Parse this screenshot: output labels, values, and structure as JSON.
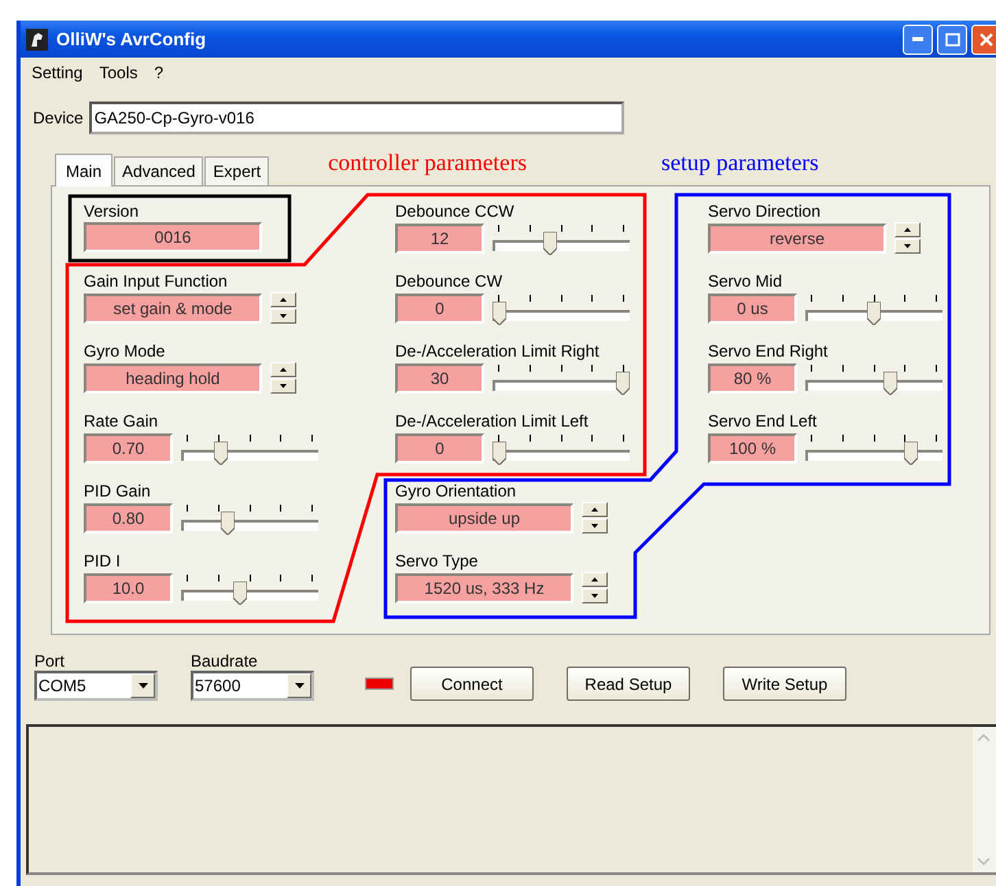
{
  "window": {
    "title": "OlliW's AvrConfig"
  },
  "menu": [
    "Setting",
    "Tools",
    "?"
  ],
  "device": {
    "label": "Device",
    "value": "GA250-Cp-Gyro-v016"
  },
  "tabs": [
    {
      "label": "Main",
      "selected": true
    },
    {
      "label": "Advanced",
      "selected": false
    },
    {
      "label": "Expert",
      "selected": false
    }
  ],
  "annotations": [
    {
      "label": "controller parameters",
      "color": "#ff0000"
    },
    {
      "label": "setup parameters",
      "color": "#0000ff"
    },
    {
      "color": "#000000"
    }
  ],
  "version": {
    "label": "Version",
    "value": "0016"
  },
  "columns": [
    [
      {
        "kind": "spinner",
        "label": "Gain Input Function",
        "value": "set gain & mode"
      },
      {
        "kind": "spinner",
        "label": "Gyro Mode",
        "value": "heading hold"
      },
      {
        "kind": "slider",
        "label": "Rate Gain",
        "value": "0.70",
        "level": 0.27
      },
      {
        "kind": "slider",
        "label": "PID Gain",
        "value": "0.80",
        "level": 0.32
      },
      {
        "kind": "slider",
        "label": "PID I",
        "value": "10.0",
        "level": 0.42
      }
    ],
    [
      {
        "kind": "slider",
        "label": "Debounce CCW",
        "value": "12",
        "level": 0.41
      },
      {
        "kind": "slider",
        "label": "Debounce CW",
        "value": "0",
        "level": 0
      },
      {
        "kind": "slider",
        "label": "De-/Acceleration Limit Right",
        "value": "30",
        "level": 1
      },
      {
        "kind": "slider",
        "label": "De-/Acceleration Limit Left",
        "value": "0",
        "level": 0
      },
      {
        "kind": "spinner",
        "label": "Gyro Orientation",
        "value": "upside up"
      },
      {
        "kind": "spinner",
        "label": "Servo Type",
        "value": "1520 us, 333 Hz"
      }
    ],
    [
      {
        "kind": "spinner",
        "label": "Servo Direction",
        "value": "reverse"
      },
      {
        "kind": "slider",
        "label": "Servo Mid",
        "value": "0 us",
        "level": 0.5
      },
      {
        "kind": "slider",
        "label": "Servo End Right",
        "value": "80 %",
        "level": 0.63
      },
      {
        "kind": "slider",
        "label": "Servo End Left",
        "value": "100 %",
        "level": 0.8
      }
    ]
  ],
  "port": {
    "label": "Port",
    "value": "COM5"
  },
  "baudrate": {
    "label": "Baudrate",
    "value": "57600"
  },
  "buttons": [
    "Connect",
    "Read Setup",
    "Write Setup"
  ]
}
